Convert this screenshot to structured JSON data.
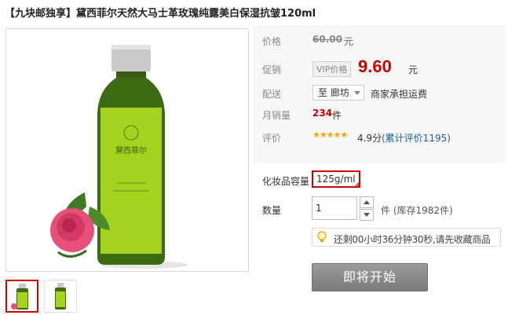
{
  "product": {
    "title": "【九块邮独享】黛西菲尔天然大马士革玫瑰纯露美白保湿抗皱120ml",
    "bottle_label_brand": "黛西菲尔"
  },
  "pricing": {
    "price_label": "价格",
    "original_price": "60.00",
    "original_unit": "元",
    "promo_label": "促销",
    "vip_badge": "VIP价格",
    "sale_price": "9.60",
    "sale_unit": "元"
  },
  "shipping": {
    "label": "配送",
    "destination": "至 廊坊",
    "note": "商家承担运费"
  },
  "sales": {
    "label": "月销量",
    "count": "234",
    "unit": "件"
  },
  "rating": {
    "label": "评价",
    "stars": "★★★★★",
    "score": "4.9分",
    "total_link": "(累计评价1195)",
    "value": 4.9,
    "max": 5
  },
  "sku": {
    "label": "化妆品容量",
    "selected_option": "125g/ml"
  },
  "quantity": {
    "label": "数量",
    "value": "1",
    "stock_text": "件 (库存1982件)"
  },
  "notice": {
    "text": "还剩00小时36分钟30秒,请先收藏商品"
  },
  "cta": {
    "label": "即将开始"
  },
  "colors": {
    "accent_red": "#c40000",
    "link_blue": "#1a5da6",
    "star_orange": "#f5a700",
    "bottle_green": "#9ccc1a",
    "cta_gray": "#888888"
  }
}
